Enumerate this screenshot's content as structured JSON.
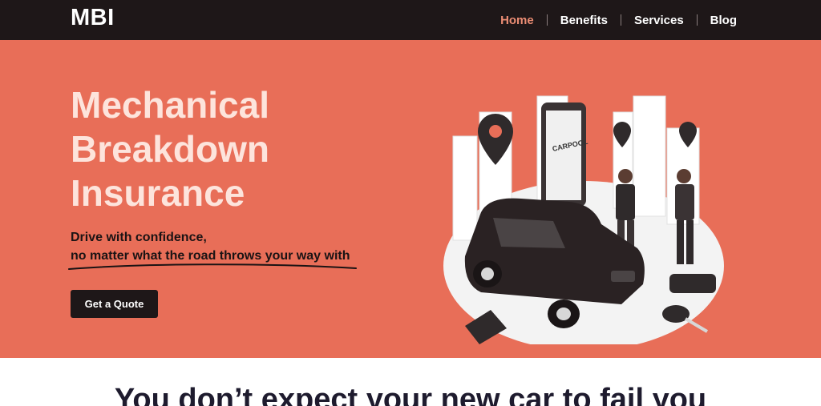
{
  "header": {
    "logo": "MBI",
    "nav": [
      "Home",
      "Benefits",
      "Services",
      "Blog"
    ]
  },
  "hero": {
    "title_lines": [
      "Mechanical",
      "Breakdown",
      "Insurance"
    ],
    "subtitle_line1": "Drive with confidence,",
    "subtitle_line2": "no matter what the road throws your way with",
    "cta": "Get a Quote",
    "illustration_label": "CARPOOL"
  },
  "section": {
    "heading": "You don’t expect your new car to fail you"
  },
  "colors": {
    "navbar": "#1e1718",
    "hero_bg": "#e86e58",
    "title": "#fde4dc",
    "nav_active": "#eb8d74",
    "button": "#1e1718"
  }
}
